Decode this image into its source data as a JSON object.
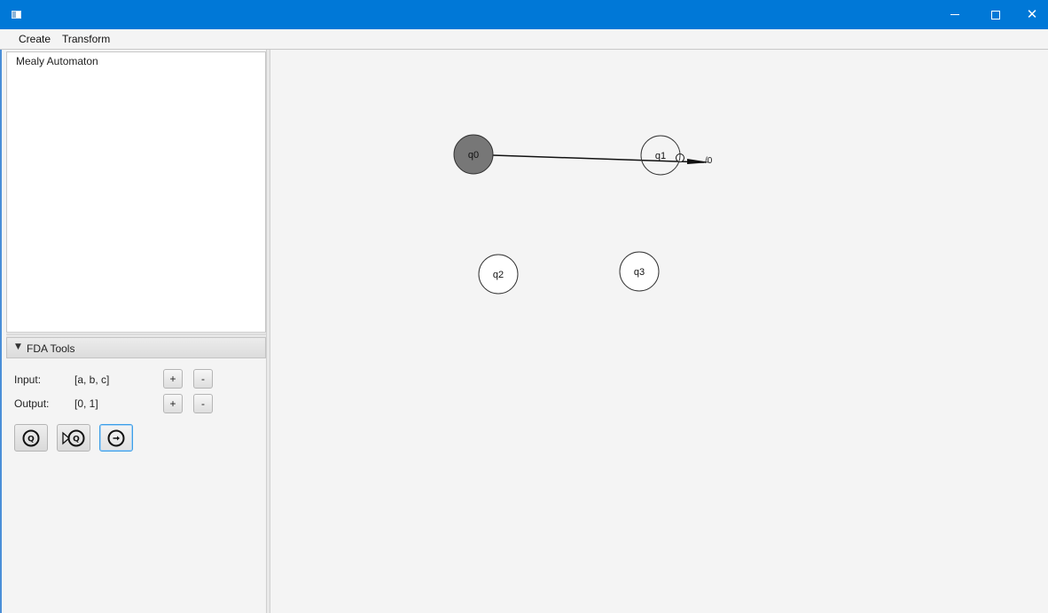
{
  "window": {
    "title": "",
    "controls": {
      "minimize": "—",
      "maximize": "□",
      "close": "✕"
    },
    "accent_color": "#0078d7"
  },
  "menu": {
    "items": [
      "Create",
      "Transform"
    ]
  },
  "tree": {
    "items": [
      "Mealy Automaton"
    ]
  },
  "tools": {
    "title": "FDA Tools",
    "input_label": "Input:",
    "input_value": "[a, b, c]",
    "output_label": "Output:",
    "output_value": "[0, 1]",
    "plus": "+",
    "minus": "-",
    "buttons": [
      {
        "icon": "add-state-icon",
        "selected": false
      },
      {
        "icon": "add-initial-state-icon",
        "selected": false
      },
      {
        "icon": "add-transition-icon",
        "selected": true
      }
    ]
  },
  "canvas": {
    "states": [
      {
        "label": "q0",
        "selected": true,
        "fill": "#777777"
      },
      {
        "label": "q1",
        "selected": false,
        "fill": "#ffffff"
      },
      {
        "label": "q2",
        "selected": false,
        "fill": "#ffffff"
      },
      {
        "label": "q3",
        "selected": false,
        "fill": "#ffffff"
      }
    ],
    "transitions": [
      {
        "from": "q0",
        "to": "q1",
        "label": "/0"
      }
    ]
  }
}
